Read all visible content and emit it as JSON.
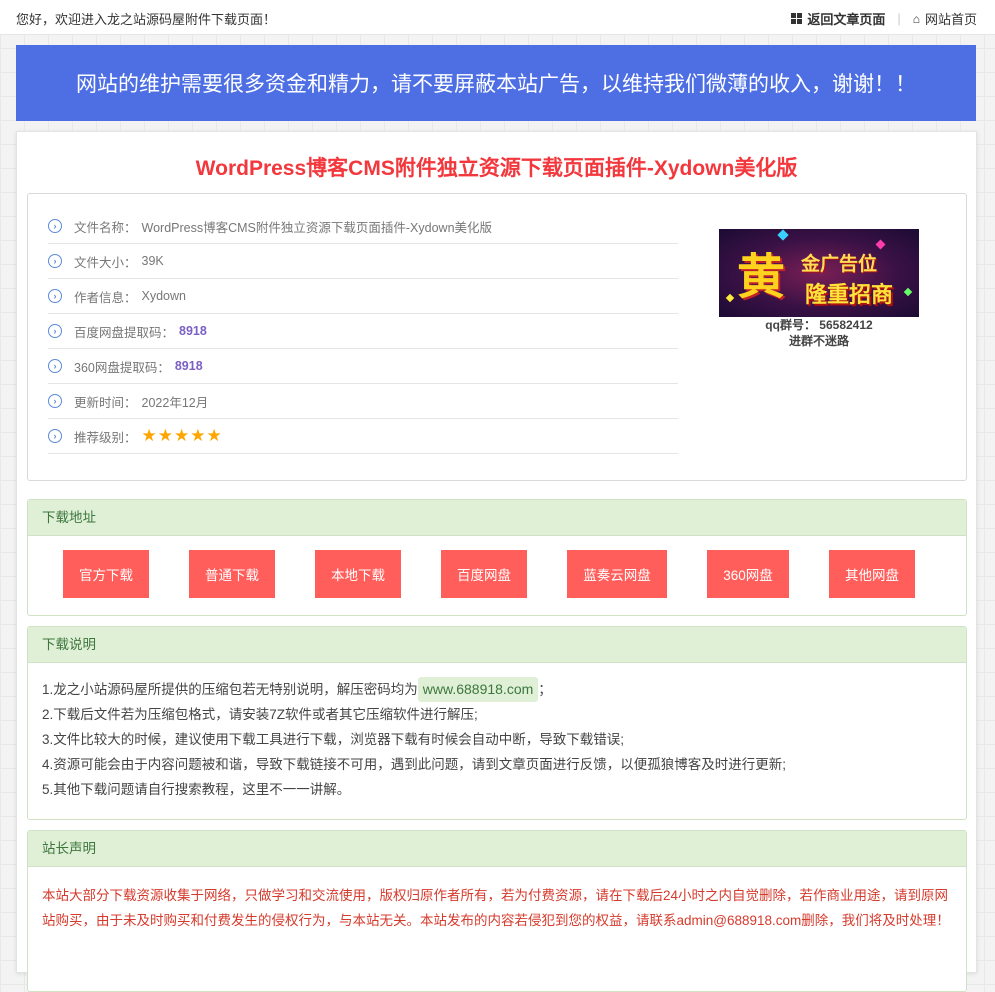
{
  "topbar": {
    "welcome": "您好，欢迎进入龙之站源码屋附件下载页面！",
    "back_link": "返回文章页面",
    "home_link": "网站首页"
  },
  "banner": {
    "text": "网站的维护需要很多资金和精力，请不要屏蔽本站广告，以维持我们微薄的收入，谢谢！！"
  },
  "title": "WordPress博客CMS附件独立资源下载页面插件-Xydown美化版",
  "info": {
    "file_name_label": "文件名称：",
    "file_name": "WordPress博客CMS附件独立资源下载页面插件-Xydown美化版",
    "file_size_label": "文件大小：",
    "file_size": "39K",
    "author_label": "作者信息：",
    "author": "Xydown",
    "baidu_code_label": "百度网盘提取码：",
    "baidu_code": "8918",
    "code360_label": "360网盘提取码：",
    "code360": "8918",
    "update_label": "更新时间：",
    "update_time": "2022年12月",
    "rating_label": "推荐级别：",
    "rating_stars": 5,
    "rating_display": "★★★★★"
  },
  "ad": {
    "big_char": "黄",
    "line1": "金广告位",
    "line2": "隆重招商",
    "qq_line": "qq群号：  56582412",
    "qq_note": "进群不迷路"
  },
  "download": {
    "header": "下载地址",
    "buttons": [
      "官方下载",
      "普通下载",
      "本地下载",
      "百度网盘",
      "蓝奏云网盘",
      "360网盘",
      "其他网盘"
    ]
  },
  "instructions": {
    "header": "下载说明",
    "line1_prefix": "1.龙之小站源码屋所提供的压缩包若无特别说明，解压密码均为",
    "password": "www.688918.com",
    "line1_suffix": "；",
    "line2": "2.下载后文件若为压缩包格式，请安装7Z软件或者其它压缩软件进行解压;",
    "line3": "3.文件比较大的时候，建议使用下载工具进行下载，浏览器下载有时候会自动中断，导致下载错误;",
    "line4": "4.资源可能会由于内容问题被和谐，导致下载链接不可用，遇到此问题，请到文章页面进行反馈，以便孤狼博客及时进行更新;",
    "line5": "5.其他下载问题请自行搜索教程，这里不一一讲解。"
  },
  "statement": {
    "header": "站长声明",
    "text": "本站大部分下载资源收集于网络，只做学习和交流使用，版权归原作者所有，若为付费资源，请在下载后24小时之内自觉删除，若作商业用途，请到原网站购买，由于未及时购买和付费发生的侵权行为，与本站无关。本站发布的内容若侵犯到您的权益，请联系admin@688918.com删除，我们将及时处理！"
  },
  "colors": {
    "banner": "#4e6fe3",
    "title": "#f2373d",
    "button": "#ff5e5b",
    "panel_header": "#e0f0d7",
    "statement_text": "#d53a2c"
  }
}
